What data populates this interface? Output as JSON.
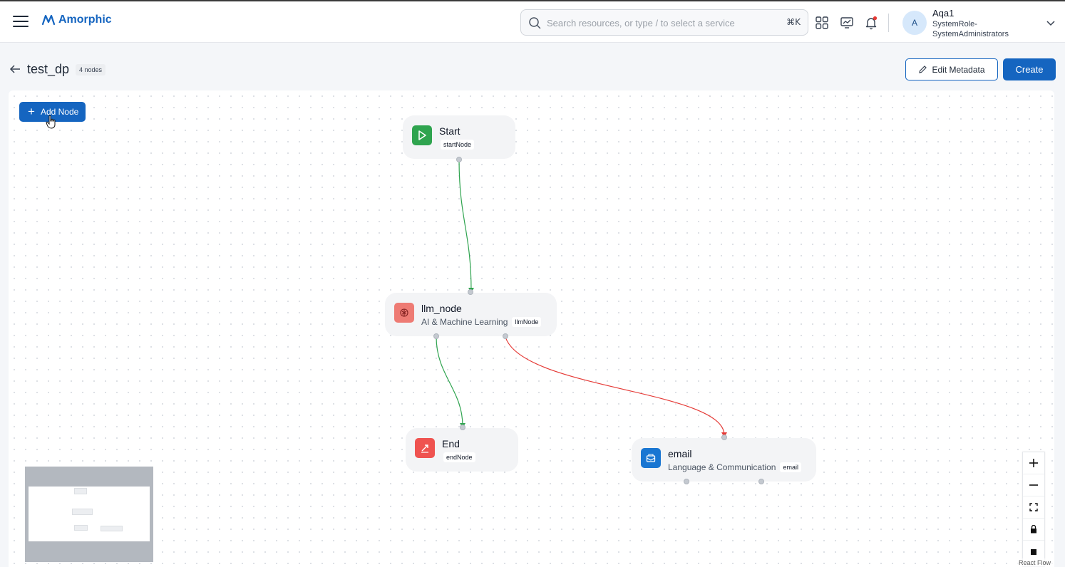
{
  "header": {
    "logo_text": "Amorphic",
    "search": {
      "placeholder": "Search resources, or type / to select a service",
      "shortcut": "⌘K"
    },
    "icons": [
      "grid-icon",
      "monitor-chart-icon",
      "bell-icon"
    ],
    "user": {
      "avatar_initial": "A",
      "name": "Aqa1",
      "role": "SystemRole-SystemAdministrators"
    }
  },
  "page": {
    "title": "test_dp",
    "node_count": "4 nodes",
    "edit_metadata_label": "Edit Metadata",
    "create_label": "Create"
  },
  "canvas": {
    "add_node_label": "Add Node",
    "nodes": [
      {
        "title": "Start",
        "subtitle": "",
        "tag": "startNode",
        "icon": "play-icon",
        "color": "#2fa44f"
      },
      {
        "title": "llm_node",
        "subtitle": "AI & Machine Learning",
        "tag": "llmNode",
        "icon": "brain-icon",
        "color": "#ee7b74"
      },
      {
        "title": "End",
        "subtitle": "",
        "tag": "endNode",
        "icon": "exit-icon",
        "color": "#ef5350"
      },
      {
        "title": "email",
        "subtitle": "Language & Communication",
        "tag": "email",
        "icon": "envelope-icon",
        "color": "#1976d2"
      }
    ],
    "edge_colors": {
      "success": "#2fa44f",
      "failure": "#e53935"
    },
    "controls": [
      "zoom-in",
      "zoom-out",
      "fit-view",
      "lock",
      "stop"
    ],
    "attribution": "React Flow"
  },
  "colors": {
    "primary": "#1565c0",
    "background": "#f4f6f9"
  }
}
